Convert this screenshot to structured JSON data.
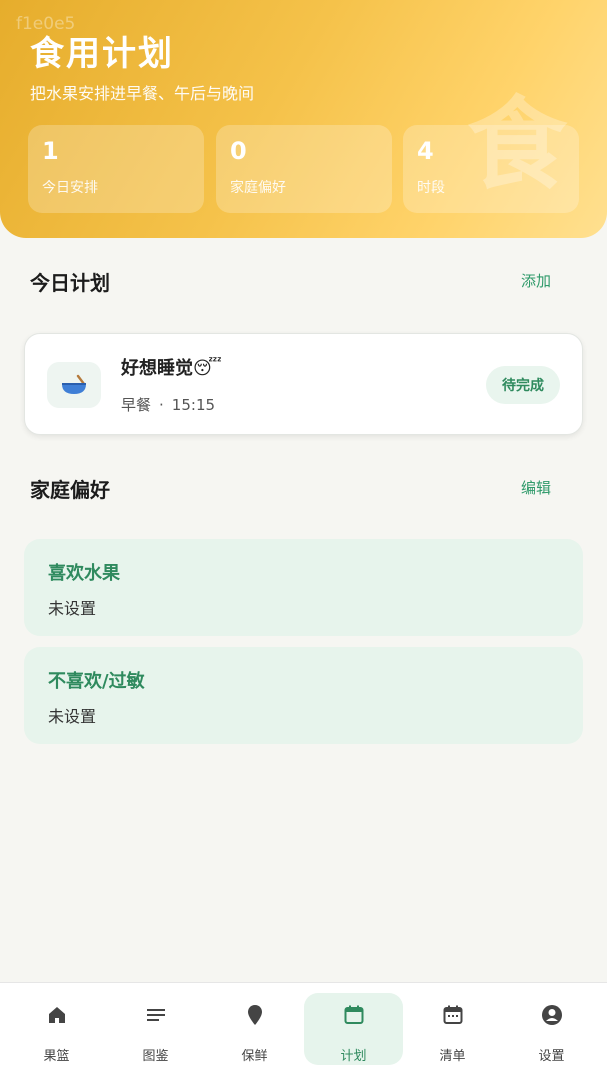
{
  "header": {
    "watermark": "f1e0e5",
    "title": "食用计划",
    "subtitle": "把水果安排进早餐、午后与晚间",
    "big_glyph": "食",
    "stats": [
      {
        "value": "1",
        "label": "今日安排"
      },
      {
        "value": "0",
        "label": "家庭偏好"
      },
      {
        "value": "4",
        "label": "时段"
      }
    ]
  },
  "today": {
    "title": "今日计划",
    "action": "添加",
    "plans": [
      {
        "name": "好想睡觉😴",
        "meal": "早餐",
        "dot": "·",
        "time": "15:15",
        "status": "待完成",
        "icon": "bowl-icon"
      }
    ]
  },
  "prefs": {
    "title": "家庭偏好",
    "action": "编辑",
    "items": [
      {
        "title": "喜欢水果",
        "value": "未设置"
      },
      {
        "title": "不喜欢/过敏",
        "value": "未设置"
      }
    ]
  },
  "nav": {
    "active_color": "#2f8a5e",
    "items": [
      {
        "label": "果篮",
        "icon": "home-icon"
      },
      {
        "label": "图鉴",
        "icon": "list-icon"
      },
      {
        "label": "保鲜",
        "icon": "location-pin-icon"
      },
      {
        "label": "计划",
        "icon": "calendar-icon",
        "active": true
      },
      {
        "label": "清单",
        "icon": "calendar-list-icon"
      },
      {
        "label": "设置",
        "icon": "account-icon"
      }
    ]
  }
}
